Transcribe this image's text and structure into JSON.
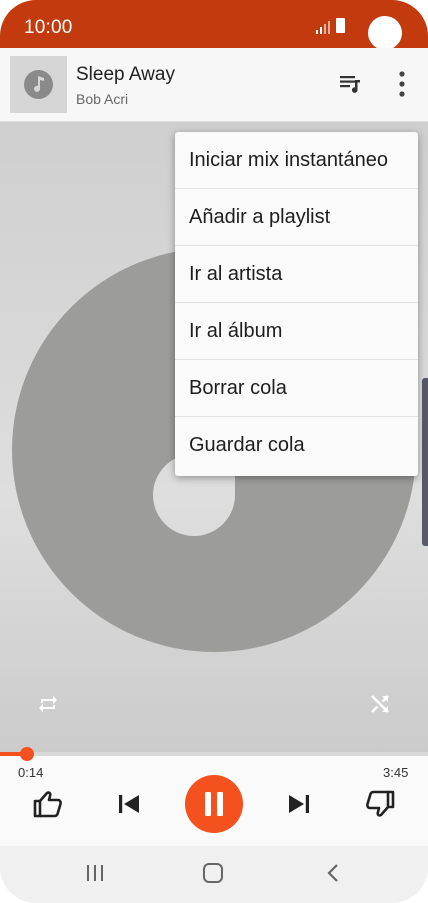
{
  "status_bar": {
    "time": "10:00"
  },
  "now_playing": {
    "title": "Sleep Away",
    "artist": "Bob Acri"
  },
  "menu": {
    "items": [
      {
        "label": "Iniciar mix instantáneo"
      },
      {
        "label": "Añadir a playlist"
      },
      {
        "label": "Ir al artista"
      },
      {
        "label": "Ir al álbum"
      },
      {
        "label": "Borrar cola"
      },
      {
        "label": "Guardar cola"
      }
    ]
  },
  "playback": {
    "current_time": "0:14",
    "total_time": "3:45",
    "progress": 0.062
  },
  "colors": {
    "status_bar": "#c33a0f",
    "accent": "#f4511e",
    "disc": "#9c9d9b"
  },
  "icons": {
    "header": [
      "music-note-icon",
      "queue-music-icon",
      "more-vert-icon"
    ],
    "art": [
      "repeat-icon",
      "shuffle-icon"
    ],
    "controls": [
      "thumb-up-icon",
      "skip-previous-icon",
      "pause-icon",
      "skip-next-icon",
      "thumb-down-icon"
    ],
    "nav": [
      "recents-icon",
      "home-icon",
      "back-icon"
    ]
  }
}
